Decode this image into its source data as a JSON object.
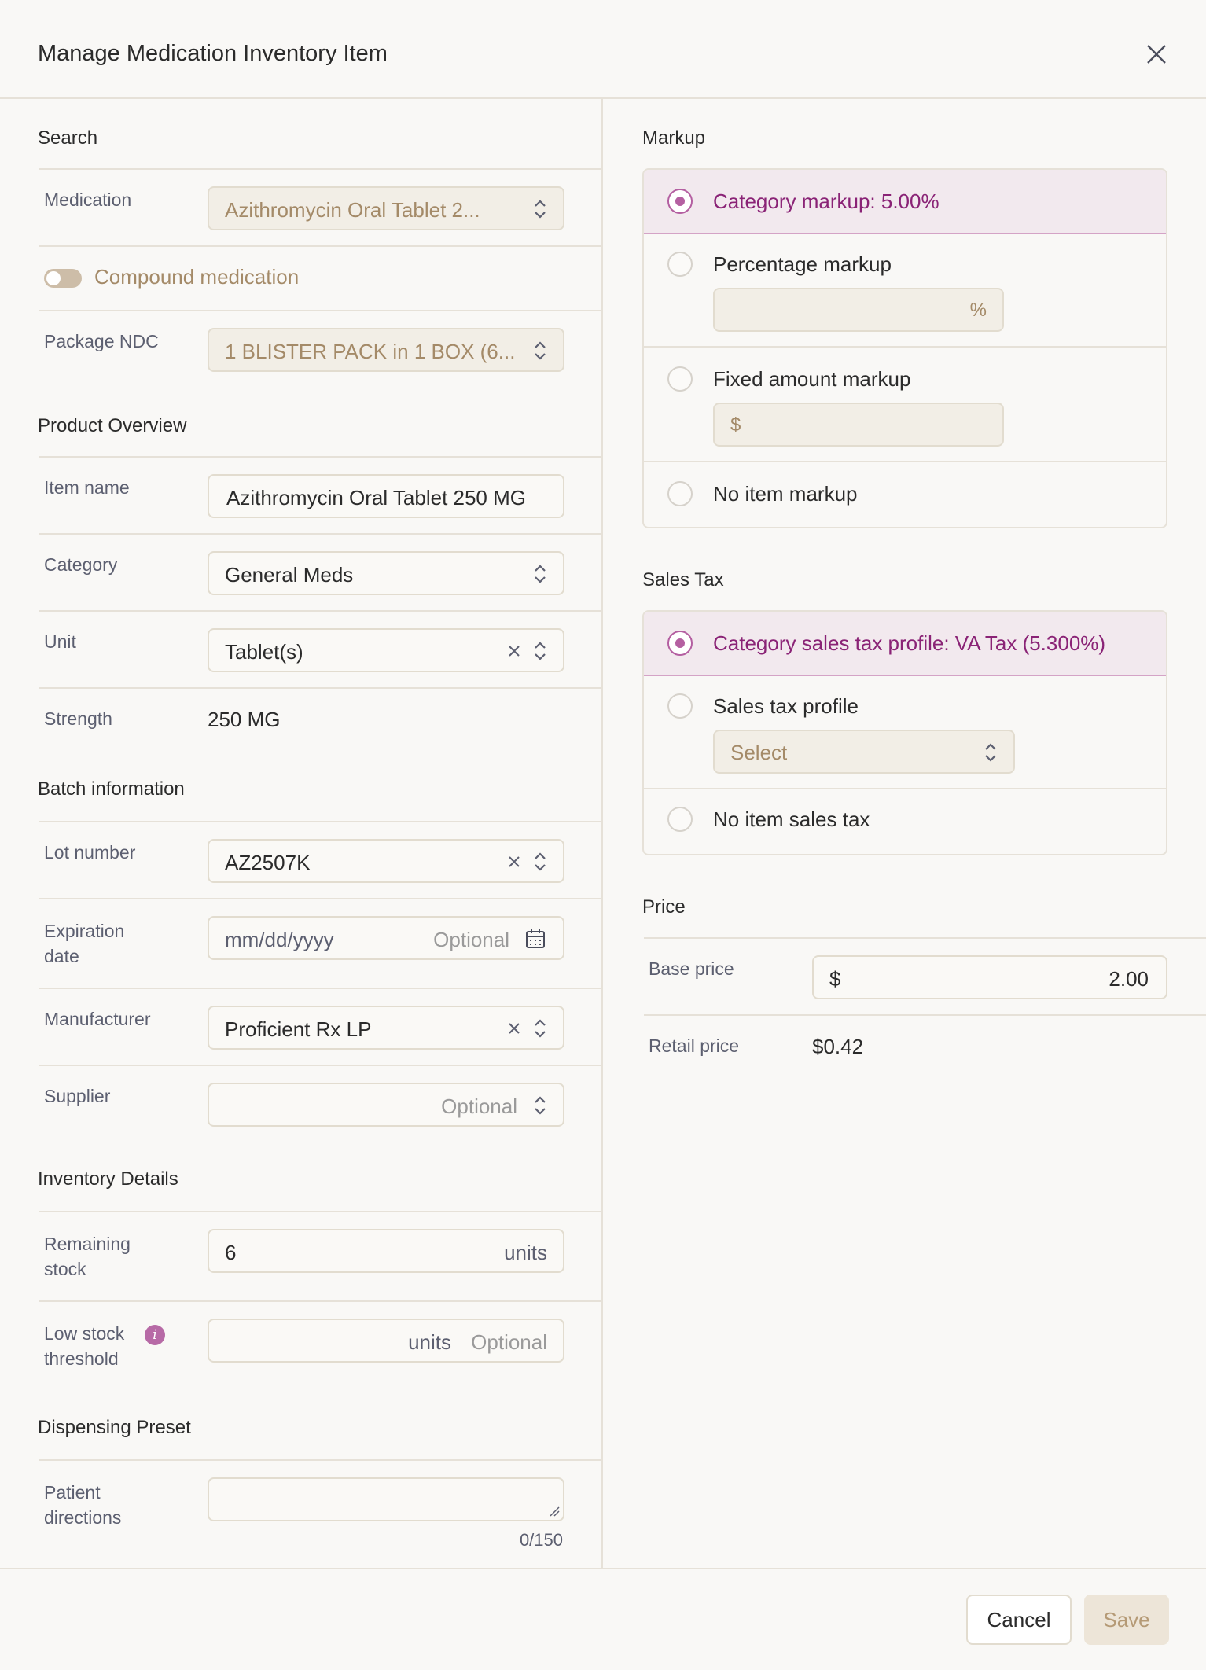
{
  "dialog": {
    "title": "Manage Medication Inventory Item"
  },
  "search": {
    "section_title": "Search",
    "medication_label": "Medication",
    "medication_value": "Azithromycin Oral Tablet 2...",
    "compound_label": "Compound medication",
    "compound_on": false,
    "ndc_label": "Package NDC",
    "ndc_value": "1 BLISTER PACK in 1 BOX (6..."
  },
  "product": {
    "section_title": "Product Overview",
    "item_name_label": "Item name",
    "item_name_value": "Azithromycin Oral Tablet 250 MG",
    "category_label": "Category",
    "category_value": "General Meds",
    "unit_label": "Unit",
    "unit_value": "Tablet(s)",
    "strength_label": "Strength",
    "strength_value": "250 MG"
  },
  "batch": {
    "section_title": "Batch information",
    "lot_label": "Lot number",
    "lot_value": "AZ2507K",
    "exp_label_1": "Expiration",
    "exp_label_2": "date",
    "exp_placeholder": "mm/dd/yyyy",
    "exp_optional": "Optional",
    "manufacturer_label": "Manufacturer",
    "manufacturer_value": "Proficient Rx LP",
    "supplier_label": "Supplier",
    "supplier_optional": "Optional"
  },
  "inventory": {
    "section_title": "Inventory Details",
    "remaining_label_1": "Remaining",
    "remaining_label_2": "stock",
    "remaining_value": "6",
    "remaining_unit": "units",
    "low_label_1": "Low stock",
    "low_label_2": "threshold",
    "low_info": "i",
    "low_unit": "units",
    "low_optional": "Optional"
  },
  "dispensing": {
    "section_title": "Dispensing Preset",
    "patient_label_1": "Patient",
    "patient_label_2": "directions",
    "counter": "0/150"
  },
  "markup": {
    "section_title": "Markup",
    "opt_category": "Category markup: 5.00%",
    "opt_percentage": "Percentage markup",
    "percent_symbol": "%",
    "opt_fixed": "Fixed amount markup",
    "dollar_symbol": "$",
    "opt_none": "No item markup"
  },
  "sales_tax": {
    "section_title": "Sales Tax",
    "opt_category": "Category sales tax profile: VA Tax (5.300%)",
    "opt_profile": "Sales tax profile",
    "profile_placeholder": "Select",
    "opt_none": "No item sales tax"
  },
  "price": {
    "section_title": "Price",
    "base_label": "Base price",
    "base_currency": "$",
    "base_value": "2.00",
    "retail_label": "Retail price",
    "retail_value": "$0.42"
  },
  "footer": {
    "cancel_label": "Cancel",
    "save_label": "Save"
  },
  "colors": {
    "accent": "#b45fa1",
    "accent_text": "#8a2376",
    "muted": "#a48a68",
    "border": "#e6e1d8"
  }
}
